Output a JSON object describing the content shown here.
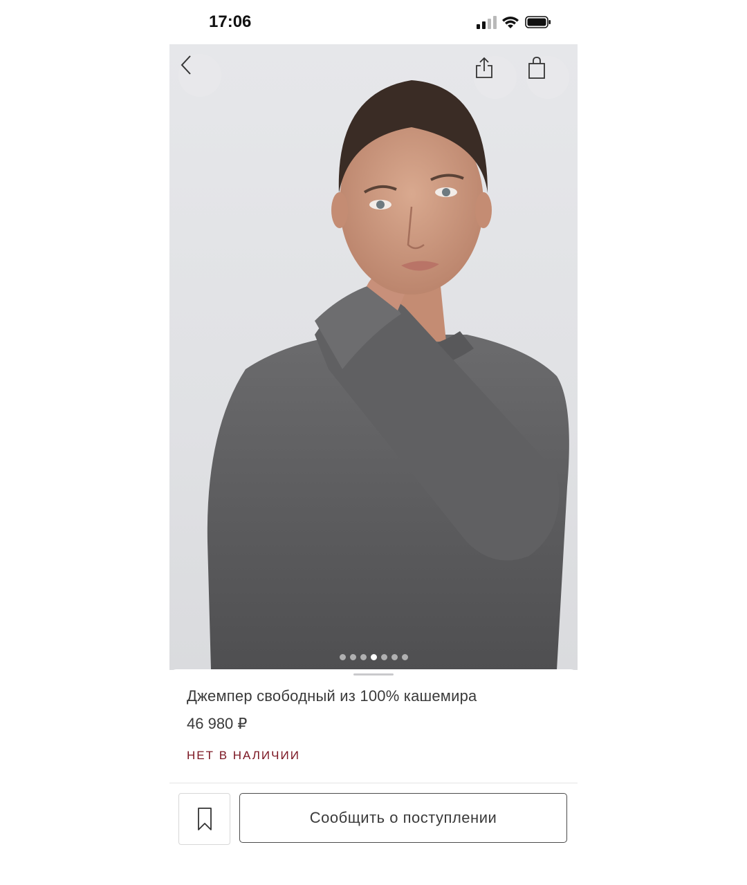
{
  "status_bar": {
    "time": "17:06",
    "icons": [
      "cellular-signal-icon",
      "wifi-icon",
      "battery-icon"
    ]
  },
  "gallery": {
    "image_description_icon": "product-photo",
    "page_count": 7,
    "active_index": 3
  },
  "top_actions": {
    "back_icon": "chevron-left-icon",
    "share_icon": "share-icon",
    "bag_icon": "shopping-bag-icon"
  },
  "product": {
    "title": "Джемпер свободный из 100% кашемира",
    "price": "46 980 ₽",
    "stock_status": "НЕТ В НАЛИЧИИ"
  },
  "actions": {
    "bookmark_icon": "bookmark-icon",
    "notify_label": "Сообщить о поступлении"
  },
  "colors": {
    "stock_status": "#7a1420",
    "text": "#3a3a3a",
    "hero_background": "#e2e3e6"
  }
}
